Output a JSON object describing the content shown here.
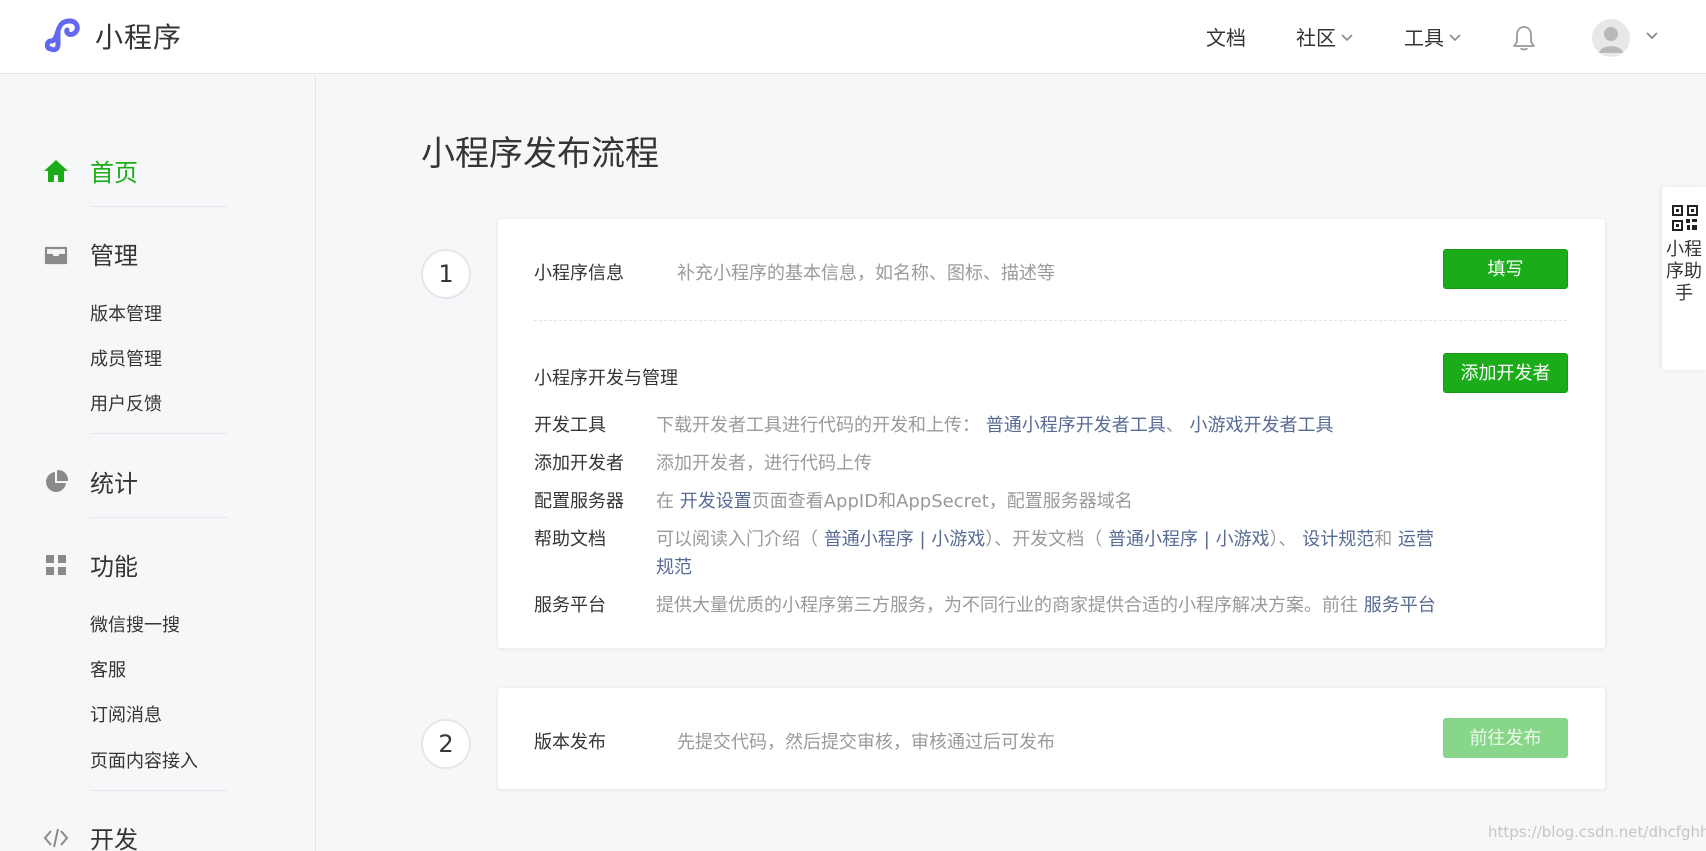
{
  "brand": {
    "name": "小程序"
  },
  "topnav": {
    "docs": "文档",
    "community": "社区",
    "tools": "工具"
  },
  "sidebar": {
    "home": "首页",
    "manage": {
      "label": "管理",
      "items": [
        "版本管理",
        "成员管理",
        "用户反馈"
      ]
    },
    "stats": "统计",
    "features": {
      "label": "功能",
      "items": [
        "微信搜一搜",
        "客服",
        "订阅消息",
        "页面内容接入"
      ]
    },
    "develop": "开发"
  },
  "main": {
    "title": "小程序发布流程",
    "step1": {
      "number": "1",
      "info_title": "小程序信息",
      "info_desc": "补充小程序的基本信息，如名称、图标、描述等",
      "fill_button": "填写",
      "dev_title": "小程序开发与管理",
      "add_dev_button": "添加开发者",
      "rows": {
        "tools": {
          "label": "开发工具",
          "text": "下载开发者工具进行代码的开发和上传：",
          "link1": "普通小程序开发者工具",
          "sep": "、",
          "link2": "小游戏开发者工具"
        },
        "adddev": {
          "label": "添加开发者",
          "text": "添加开发者，进行代码上传"
        },
        "server": {
          "label": "配置服务器",
          "pre": "在",
          "link": "开发设置",
          "post": "页面查看AppID和AppSecret，配置服务器域名"
        },
        "help": {
          "label": "帮助文档",
          "t1": "可以阅读入门介绍（",
          "l1": "普通小程序",
          "bar1": "|",
          "l2": "小游戏",
          "t2": "）、开发文档（",
          "l3": "普通小程序",
          "bar2": "|",
          "l4": "小游戏",
          "t3": "）、",
          "l5": "设计规范",
          "t4": "和",
          "l6": "运营规范"
        },
        "platform": {
          "label": "服务平台",
          "text": "提供大量优质的小程序第三方服务，为不同行业的商家提供合适的小程序解决方案。前往",
          "link": "服务平台"
        }
      }
    },
    "step2": {
      "number": "2",
      "title": "版本发布",
      "desc": "先提交代码，然后提交审核，审核通过后可发布",
      "button": "前往发布"
    }
  },
  "helper": {
    "label": "小程序助手"
  },
  "watermark": "https://blog.csdn.net/dhcfghhn",
  "colors": {
    "accent": "#1aad19",
    "link": "#576b95",
    "disabled_button": "#88d689"
  },
  "icons": {
    "home": "home-icon",
    "manage": "inbox-icon",
    "stats": "pie-chart-icon",
    "features": "grid-icon",
    "develop": "code-icon",
    "bell": "bell-icon",
    "avatar": "user-avatar-icon",
    "qr": "qr-code-icon",
    "logo": "miniprogram-logo-icon"
  }
}
